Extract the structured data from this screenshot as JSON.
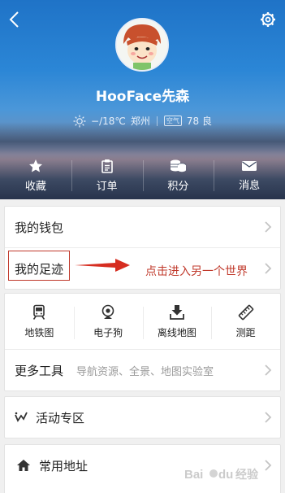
{
  "header": {
    "username": "HooFace先森",
    "weather": {
      "temperature": "−/18℃",
      "city": "郑州",
      "aqi_badge": "空气",
      "aqi_value": "78 良"
    },
    "quick_actions": [
      {
        "label": "收藏",
        "icon": "star-icon"
      },
      {
        "label": "订单",
        "icon": "clipboard-icon"
      },
      {
        "label": "积分",
        "icon": "coins-icon"
      },
      {
        "label": "消息",
        "icon": "envelope-icon"
      }
    ]
  },
  "menu": {
    "wallet": "我的钱包",
    "footprint": "我的足迹"
  },
  "annotation": {
    "text": "点击进入另一个世界",
    "color": "#c0392b"
  },
  "tools": {
    "items": [
      {
        "label": "地铁图",
        "icon": "subway-icon"
      },
      {
        "label": "电子狗",
        "icon": "camera-icon"
      },
      {
        "label": "离线地图",
        "icon": "download-icon"
      },
      {
        "label": "测距",
        "icon": "ruler-icon"
      }
    ],
    "more_label": "更多工具",
    "more_desc": "导航资源、全景、地图实验室"
  },
  "activity": {
    "label": "活动专区",
    "icon": "activity-icon"
  },
  "address": {
    "label": "常用地址",
    "icon": "home-icon"
  },
  "watermark": {
    "text": "经验"
  }
}
